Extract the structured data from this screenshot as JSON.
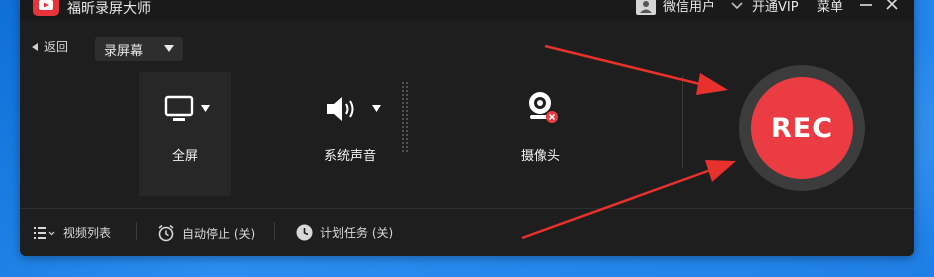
{
  "app": {
    "title": "福昕录屏大师",
    "brand_color": "#e8333b"
  },
  "titlebar": {
    "user_name": "微信用户",
    "vip_label": "开通VIP",
    "menu_label": "菜单"
  },
  "toolbar": {
    "back_label": "返回",
    "mode_selected": "录屏幕"
  },
  "sources": {
    "screen_label": "全屏",
    "audio_label": "系统声音",
    "camera_label": "摄像头"
  },
  "record": {
    "label": "REC",
    "color": "#ec3c43"
  },
  "bottom": {
    "video_list_label": "视频列表",
    "auto_stop_label": "自动停止 (关)",
    "scheduled_task_label": "计划任务 (关)"
  },
  "annotation": {
    "arrow_color": "#e8312c"
  }
}
